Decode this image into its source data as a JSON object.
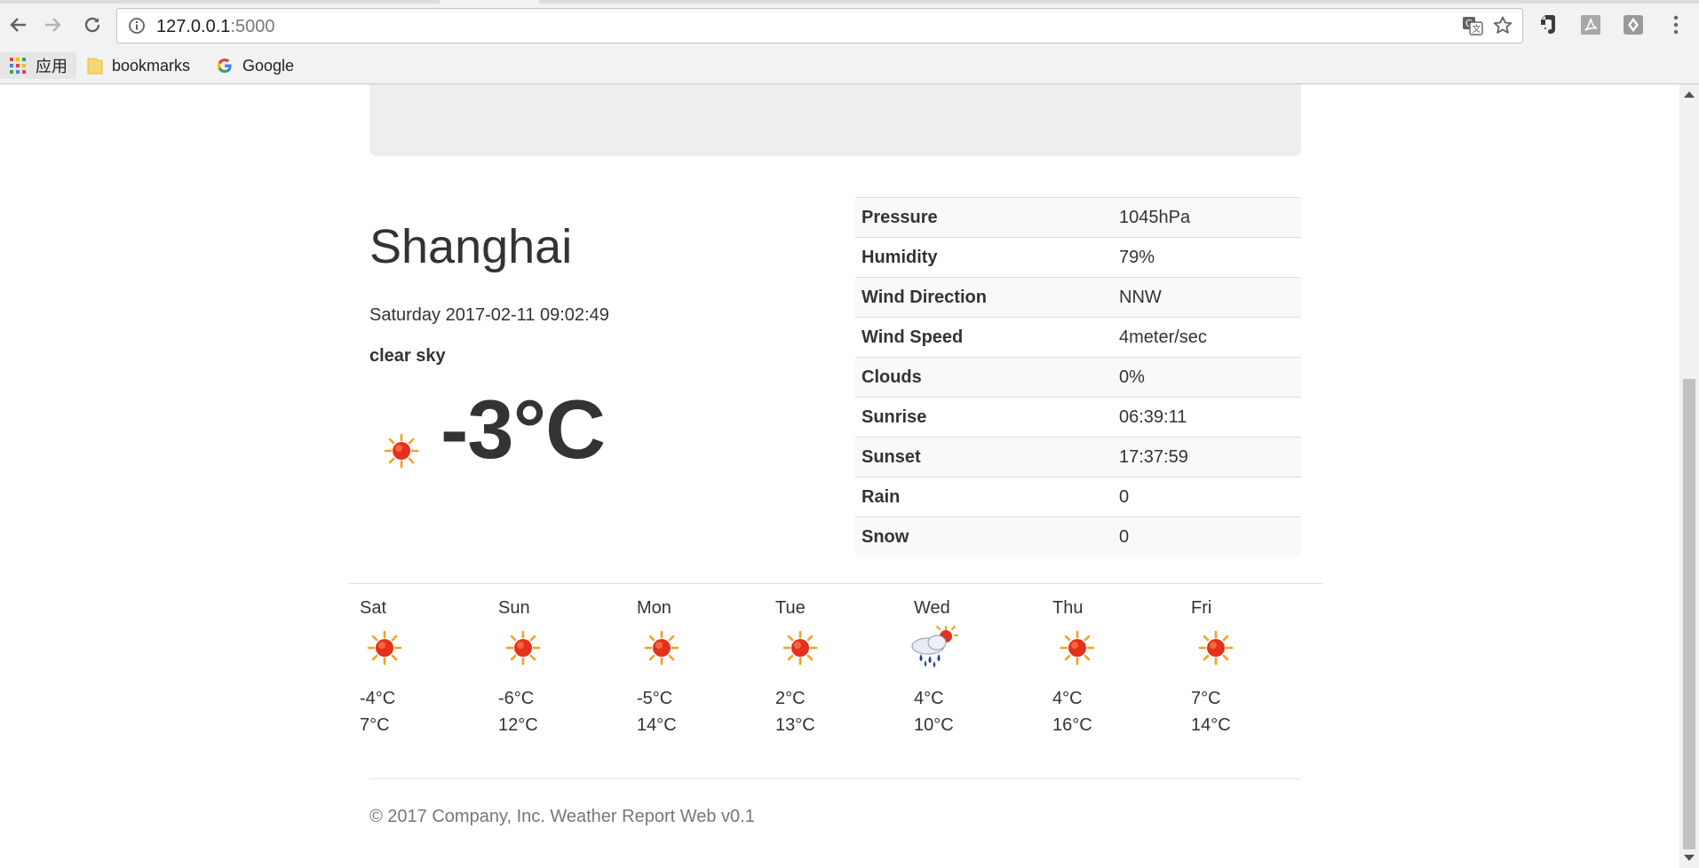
{
  "browser": {
    "url_host": "127.0.0.1",
    "url_port": ":5000",
    "bookmarks": [
      {
        "label": "应用",
        "icon": "apps-grid-icon"
      },
      {
        "label": "bookmarks",
        "icon": "folder-icon"
      },
      {
        "label": "Google",
        "icon": "google-icon"
      }
    ]
  },
  "weather": {
    "city": "Shanghai",
    "datetime": "Saturday 2017-02-11 09:02:49",
    "description": "clear sky",
    "temperature": "-3°C",
    "icon": "sun-icon",
    "details": [
      {
        "label": "Pressure",
        "value": "1045hPa"
      },
      {
        "label": "Humidity",
        "value": "79%"
      },
      {
        "label": "Wind Direction",
        "value": "NNW"
      },
      {
        "label": "Wind Speed",
        "value": "4meter/sec"
      },
      {
        "label": "Clouds",
        "value": "0%"
      },
      {
        "label": "Sunrise",
        "value": "06:39:11"
      },
      {
        "label": "Sunset",
        "value": "17:37:59"
      },
      {
        "label": "Rain",
        "value": "0"
      },
      {
        "label": "Snow",
        "value": "0"
      }
    ]
  },
  "forecast": [
    {
      "day": "Sat",
      "min": "-4°C",
      "max": "7°C",
      "icon": "sun-icon"
    },
    {
      "day": "Sun",
      "min": "-6°C",
      "max": "12°C",
      "icon": "sun-icon"
    },
    {
      "day": "Mon",
      "min": "-5°C",
      "max": "14°C",
      "icon": "sun-icon"
    },
    {
      "day": "Tue",
      "min": "2°C",
      "max": "13°C",
      "icon": "sun-icon"
    },
    {
      "day": "Wed",
      "min": "4°C",
      "max": "10°C",
      "icon": "rain-sun-icon"
    },
    {
      "day": "Thu",
      "min": "4°C",
      "max": "16°C",
      "icon": "sun-icon"
    },
    {
      "day": "Fri",
      "min": "7°C",
      "max": "14°C",
      "icon": "sun-icon"
    }
  ],
  "footer": {
    "text": "© 2017 Company, Inc. Weather Report Web v0.1"
  }
}
